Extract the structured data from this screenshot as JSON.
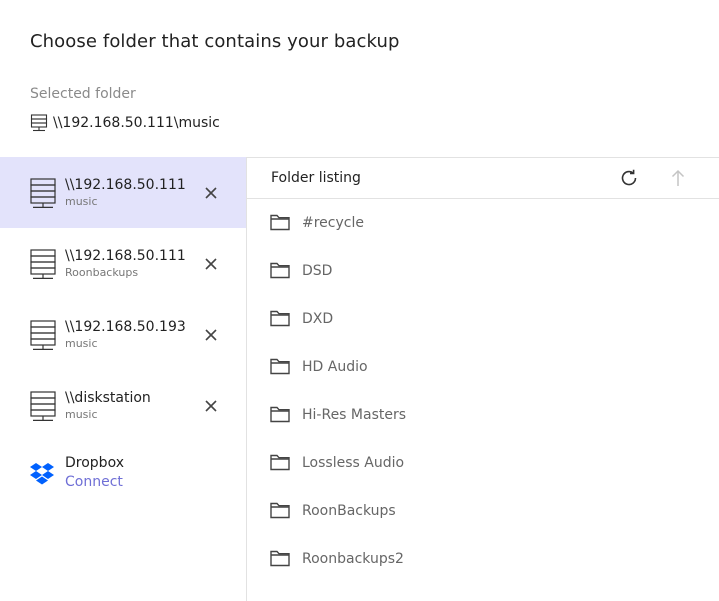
{
  "dialog": {
    "title": "Choose folder that contains your backup"
  },
  "selected": {
    "label": "Selected folder",
    "path": "\\\\192.168.50.111\\music",
    "icon": "server-icon"
  },
  "sources": [
    {
      "name": "\\\\192.168.50.111",
      "share": "music",
      "active": true
    },
    {
      "name": "\\\\192.168.50.111",
      "share": "Roonbackups",
      "active": false
    },
    {
      "name": "\\\\192.168.50.193",
      "share": "music",
      "active": false
    },
    {
      "name": "\\\\diskstation",
      "share": "music",
      "active": false
    }
  ],
  "dropbox": {
    "name": "Dropbox",
    "action": "Connect",
    "icon": "dropbox-icon"
  },
  "listing": {
    "header": "Folder listing",
    "refresh_icon": "refresh-icon",
    "up_icon": "arrow-up-icon",
    "folders": [
      "#recycle",
      "DSD",
      "DXD",
      "HD Audio",
      "Hi-Res Masters",
      "Lossless Audio",
      "RoonBackups",
      "Roonbackups2"
    ]
  },
  "colors": {
    "active_bg": "#e3e3fb",
    "accent": "#6f6fd6",
    "dropbox_blue": "#0061fe"
  }
}
